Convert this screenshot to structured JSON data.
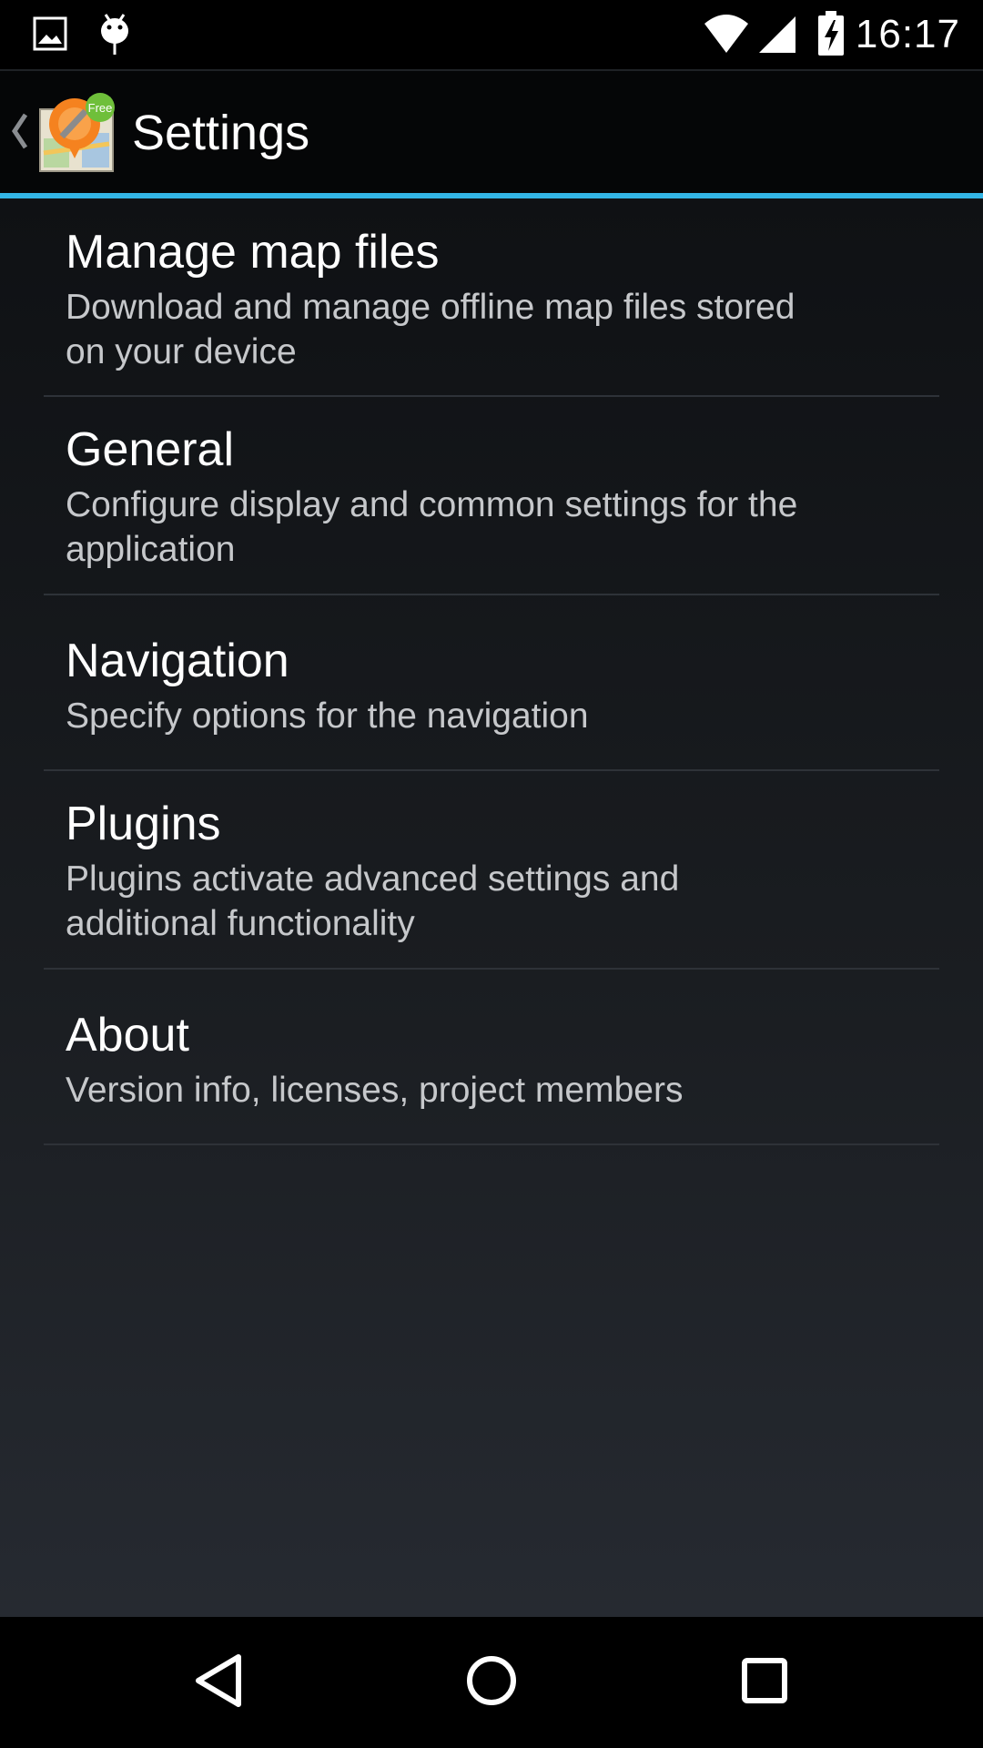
{
  "status_bar": {
    "time": "16:17",
    "left_icons": [
      "image-icon",
      "android-debug-icon"
    ],
    "right_icons": [
      "wifi-icon",
      "cell-signal-icon",
      "battery-charging-icon"
    ]
  },
  "action_bar": {
    "title": "Settings",
    "logo_badge": "Free",
    "accent_color": "#33b5e5"
  },
  "preferences": [
    {
      "title": "Manage map files",
      "summary_lines": [
        "Download and manage offline map files stored",
        "on your device"
      ]
    },
    {
      "title": "General",
      "summary_lines": [
        "Configure display and common settings for the",
        "application"
      ]
    },
    {
      "title": "Navigation",
      "summary_lines": [
        "Specify options for the navigation"
      ]
    },
    {
      "title": "Plugins",
      "summary_lines": [
        "Plugins activate advanced settings and",
        "additional functionality"
      ]
    },
    {
      "title": "About",
      "summary_lines": [
        "Version info, licenses, project members"
      ]
    }
  ],
  "nav_bar": {
    "buttons": [
      "back-icon",
      "home-icon",
      "recents-icon"
    ]
  }
}
